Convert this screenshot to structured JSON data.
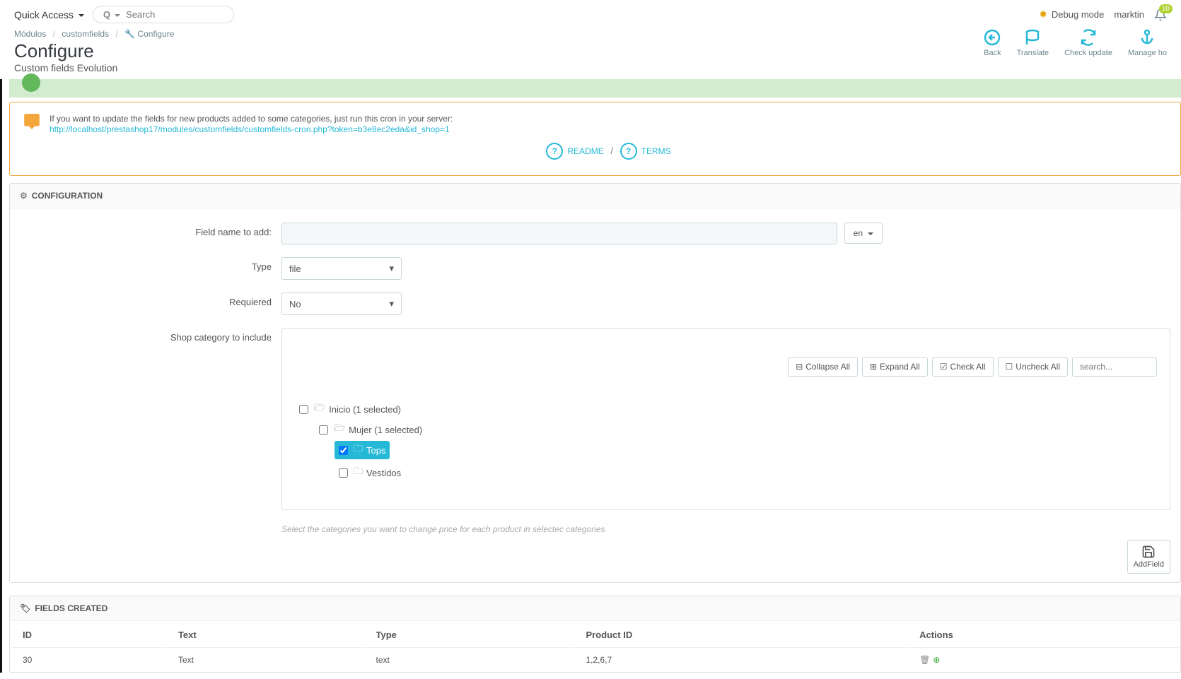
{
  "topbar": {
    "quick_access": "Quick Access",
    "search_placeholder": "Search",
    "debug_mode": "Debug mode",
    "user": "marktin",
    "notif_count": "10"
  },
  "breadcrumb": {
    "item1": "Módulos",
    "item2": "customfields",
    "item3": "Configure"
  },
  "page": {
    "title": "Configure",
    "subtitle": "Custom fields Evolution"
  },
  "toolbar": {
    "back": "Back",
    "translate": "Translate",
    "check_update": "Check update",
    "manage_hooks": "Manage ho"
  },
  "warn": {
    "msg": "If you want to update the fields for new products added to some categories, just run this cron in your server:",
    "cron_url": "http://localhost/prestashop17/modules/customfields/customfields-cron.php?token=b3e8ec2eda&id_shop=1",
    "readme": "README",
    "terms": "TERMS"
  },
  "config": {
    "panel_title": "CONFIGURATION",
    "field_name_label": "Field name to add:",
    "lang_btn": "en",
    "type_label": "Type",
    "type_value": "file",
    "required_label": "Requiered",
    "required_value": "No",
    "category_label": "Shop category to include",
    "collapse": "Collapse All",
    "expand": "Expand All",
    "check_all": "Check All",
    "uncheck_all": "Uncheck All",
    "tree_search_placeholder": "search...",
    "tree": {
      "root": "Inicio (1 selected)",
      "mujer": "Mujer (1 selected)",
      "tops": "Tops",
      "vestidos": "Vestidos"
    },
    "hint": "Select the categories you want to change price for each product in selectec categories",
    "add_field": "AddField"
  },
  "fields_panel": {
    "title": "FIELDS CREATED",
    "headers": {
      "id": "ID",
      "text": "Text",
      "type": "Type",
      "product_id": "Product ID",
      "actions": "Actions"
    },
    "rows": [
      {
        "id": "30",
        "text": "Text",
        "type": "text",
        "product_id": "1,2,6,7"
      }
    ]
  }
}
